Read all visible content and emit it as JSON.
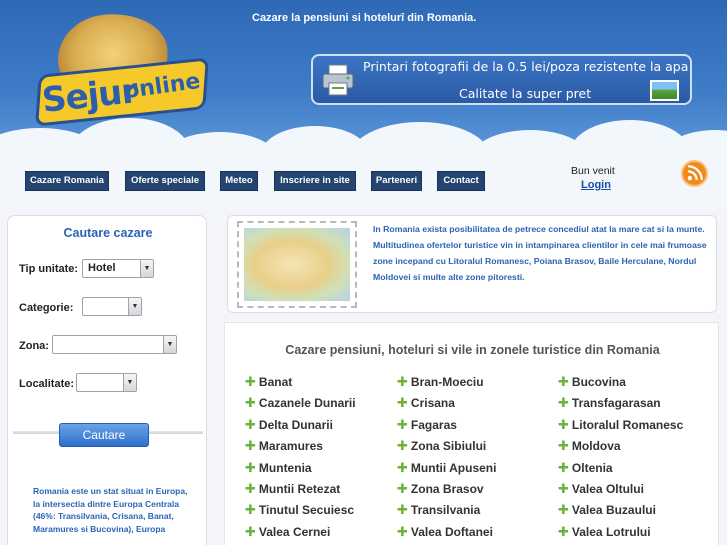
{
  "header": {
    "logo": {
      "word1": "Sejur",
      "word2": "online"
    },
    "tagline": "Cazare la pensiuni si hotelurî din Romania.",
    "promo": {
      "line1": "Printari fotografii de la 0.5 lei/poza rezistente la apa",
      "line2": "Calitate la super pret"
    }
  },
  "nav": {
    "items": [
      {
        "label": "Cazare Romania"
      },
      {
        "label": "Oferte speciale"
      },
      {
        "label": "Meteo"
      },
      {
        "label": "Inscriere in site"
      },
      {
        "label": "Parteneri"
      },
      {
        "label": "Contact"
      }
    ],
    "greeting": "Bun venit",
    "login": "Login"
  },
  "sidebar": {
    "title": "Cautare cazare",
    "fields": {
      "tip": {
        "label": "Tip unitate:",
        "value": "Hotel"
      },
      "categorie": {
        "label": "Categorie:",
        "value": ""
      },
      "zona": {
        "label": "Zona:",
        "value": ""
      },
      "localitate": {
        "label": "Localitate:",
        "value": ""
      }
    },
    "search_label": "Cautare",
    "blurb": "Romania este un stat situat in Europa, la intersectia dintre Europa Centrala (46%: Transilvania, Crisana, Banat, Maramures si Bucovina), Europa"
  },
  "intro": {
    "text": "In Romania exista posibilitatea de petrece concediul atat la mare cat si la munte. Multitudinea ofertelor turistice vin in intampinarea clientilor in cele mai frumoase zone incepand cu Litoralul Romanesc, Poiana Brasov, Baile Herculane, Nordul Moldovei si multe alte zone pitoresti."
  },
  "zones": {
    "title": "Cazare pensiuni, hoteluri si vile in zonele turistice din Romania",
    "col1": [
      "Banat",
      "Cazanele Dunarii",
      "Delta Dunarii",
      "Maramures",
      "Muntenia",
      "Muntii Retezat",
      "Tinutul Secuiesc",
      "Valea Cernei"
    ],
    "col2": [
      "Bran-Moeciu",
      "Crisana",
      "Fagaras",
      "Zona Sibiului",
      "Muntii Apuseni",
      "Zona Brasov",
      "Transilvania",
      "Valea Doftanei"
    ],
    "col3": [
      "Bucovina",
      "Transfagarasan",
      "Litoralul Romanesc",
      "Moldova",
      "Oltenia",
      "Valea Oltului",
      "Valea Buzaului",
      "Valea Lotrului"
    ]
  },
  "colors": {
    "header_blue": "#3f7dc8",
    "nav_bg": "#23456f",
    "link_blue": "#2a64b5",
    "plus_green": "#6bb33a"
  }
}
